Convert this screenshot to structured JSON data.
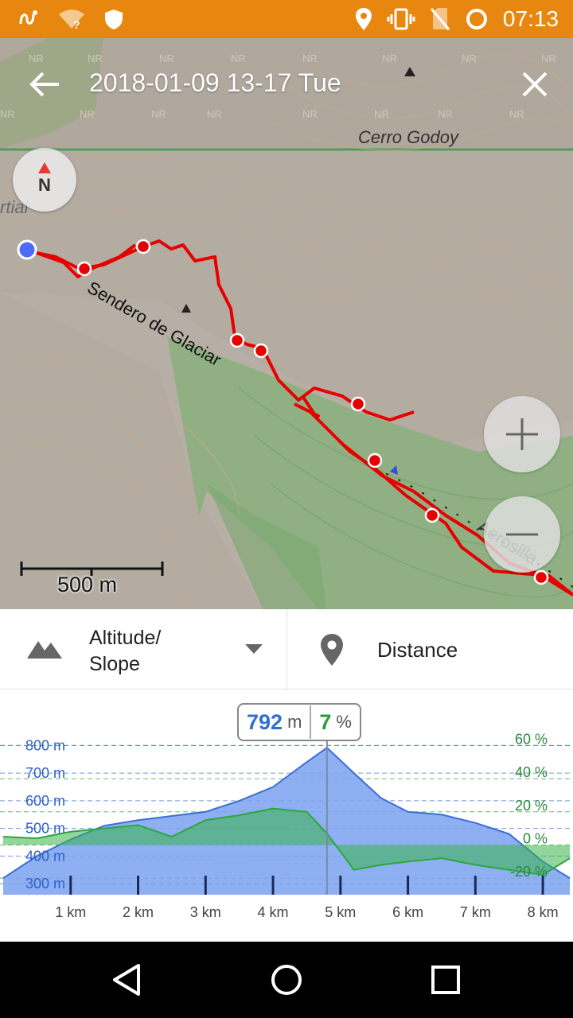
{
  "status_bar": {
    "time": "07:13",
    "icons": [
      "route-icon",
      "wifi-question-icon",
      "shield-icon",
      "location-icon",
      "vibrate-icon",
      "no-sim-icon",
      "sync-icon"
    ]
  },
  "header": {
    "title": "2018-01-09 13-17 Tue"
  },
  "map": {
    "compass_label": "N",
    "labels": {
      "peak": "Cerro Godoy",
      "trail": "Sendero de Glaciar",
      "lift": "Aerosilla",
      "partial": "rtial"
    },
    "scale_label": "500 m",
    "colors": {
      "track": "#e60000",
      "current_position": "#4a6cf7"
    }
  },
  "controls": {
    "altitude_line1": "Altitude/",
    "altitude_line2": "Slope",
    "distance_label": "Distance"
  },
  "chart_data": {
    "type": "area",
    "readout": {
      "altitude": "792",
      "altitude_unit": "m",
      "slope": "7",
      "slope_unit": "%"
    },
    "y_left_ticks": [
      "800 m",
      "700 m",
      "600 m",
      "500 m",
      "400 m",
      "300 m"
    ],
    "y_right_ticks": [
      "60 %",
      "40 %",
      "20 %",
      "0 %",
      "-20 %"
    ],
    "x_ticks": [
      "1 km",
      "2 km",
      "3 km",
      "4 km",
      "5 km",
      "6 km",
      "7 km",
      "8 km"
    ],
    "series": [
      {
        "name": "Altitude",
        "unit": "m",
        "color": "#7aa2f0",
        "x_km": [
          0,
          0.5,
          1,
          1.5,
          2,
          2.5,
          3,
          3.5,
          4,
          4.5,
          4.8,
          5.2,
          5.6,
          6,
          6.5,
          7,
          7.5,
          8,
          8.4
        ],
        "values": [
          320,
          400,
          460,
          510,
          530,
          545,
          560,
          600,
          650,
          740,
          792,
          700,
          610,
          560,
          550,
          520,
          480,
          380,
          320
        ]
      },
      {
        "name": "Slope",
        "unit": "%",
        "color": "#3bb44a",
        "x_km": [
          0,
          0.5,
          1,
          1.5,
          2,
          2.5,
          3,
          3.5,
          4,
          4.5,
          4.8,
          5.2,
          5.6,
          6,
          6.5,
          7,
          7.5,
          8,
          8.4
        ],
        "values": [
          5,
          4,
          8,
          10,
          12,
          5,
          15,
          18,
          22,
          20,
          7,
          -15,
          -12,
          -10,
          -8,
          -12,
          -15,
          -18,
          -8
        ]
      }
    ],
    "cursor_km": 4.8,
    "grid": "dashed"
  },
  "nav_bar": {
    "icons": [
      "back-triangle-icon",
      "home-circle-icon",
      "recents-square-icon"
    ]
  }
}
